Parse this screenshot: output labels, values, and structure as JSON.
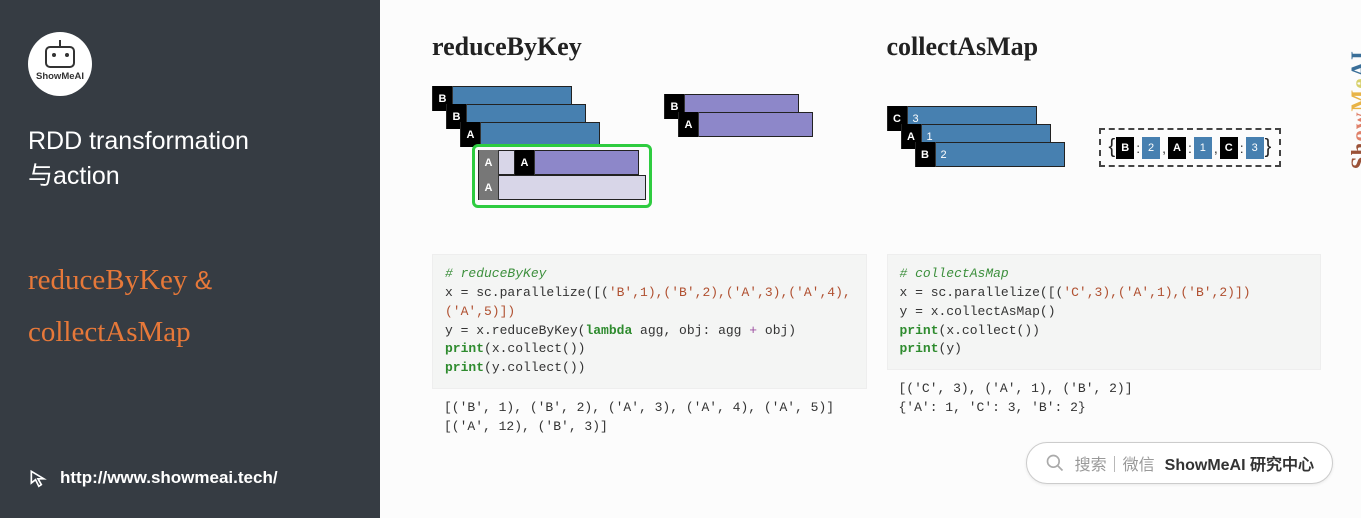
{
  "sidebar": {
    "logo_text": "ShowMeAI",
    "title_line1": "RDD transformation",
    "title_line2": "与action",
    "hl_reduce": "reduceByKey",
    "hl_amp": "&",
    "hl_collect": "collectAsMap",
    "url": "http://www.showmeai.tech/"
  },
  "left": {
    "title": "reduceByKey",
    "stack1_keys": [
      "B",
      "B",
      "A",
      "A",
      "A"
    ],
    "stack2_keys": [
      "B",
      "A"
    ],
    "code_comment": "# reduceByKey",
    "code_l1_pre": "x = sc.parallelize([(",
    "code_l1_pairs": "'B',1),('B',2),('A',3),('A',4),('A',5)])",
    "code_l2": "y = x.reduceByKey(",
    "code_l2_kw": "lambda",
    "code_l2_rest": " agg, obj: agg ",
    "code_l2_op": "+",
    "code_l2_tail": " obj)",
    "code_l3a": "print",
    "code_l3b": "(x.collect())",
    "code_l4a": "print",
    "code_l4b": "(y.collect())",
    "out1": "[('B', 1), ('B', 2), ('A', 3), ('A', 4), ('A', 5)]",
    "out2": "[('A', 12), ('B', 3)]"
  },
  "right": {
    "title": "collectAsMap",
    "stack_keys": [
      "C",
      "A",
      "B"
    ],
    "stack_vals": [
      "3",
      "1",
      "2"
    ],
    "map_pairs": [
      [
        "B",
        "2"
      ],
      [
        "A",
        "1"
      ],
      [
        "C",
        "3"
      ]
    ],
    "code_comment": "# collectAsMap",
    "code_l1_pre": "x = sc.parallelize([(",
    "code_l1_pairs": "'C',3),('A',1),('B',2)])",
    "code_l2": "y = x.collectAsMap()",
    "code_l3a": "print",
    "code_l3b": "(x.collect())",
    "code_l4a": "print",
    "code_l4b": "(y)",
    "out1": "[('C', 3), ('A', 1), ('B', 2)]",
    "out2": "{'A': 1, 'C': 3, 'B': 2}"
  },
  "search": {
    "hint": "搜索｜微信",
    "bold": "ShowMeAI 研究中心"
  },
  "watermark": "ShowMeAI",
  "colors": {
    "blue": "#4780b0",
    "purple": "#8d87c9"
  }
}
